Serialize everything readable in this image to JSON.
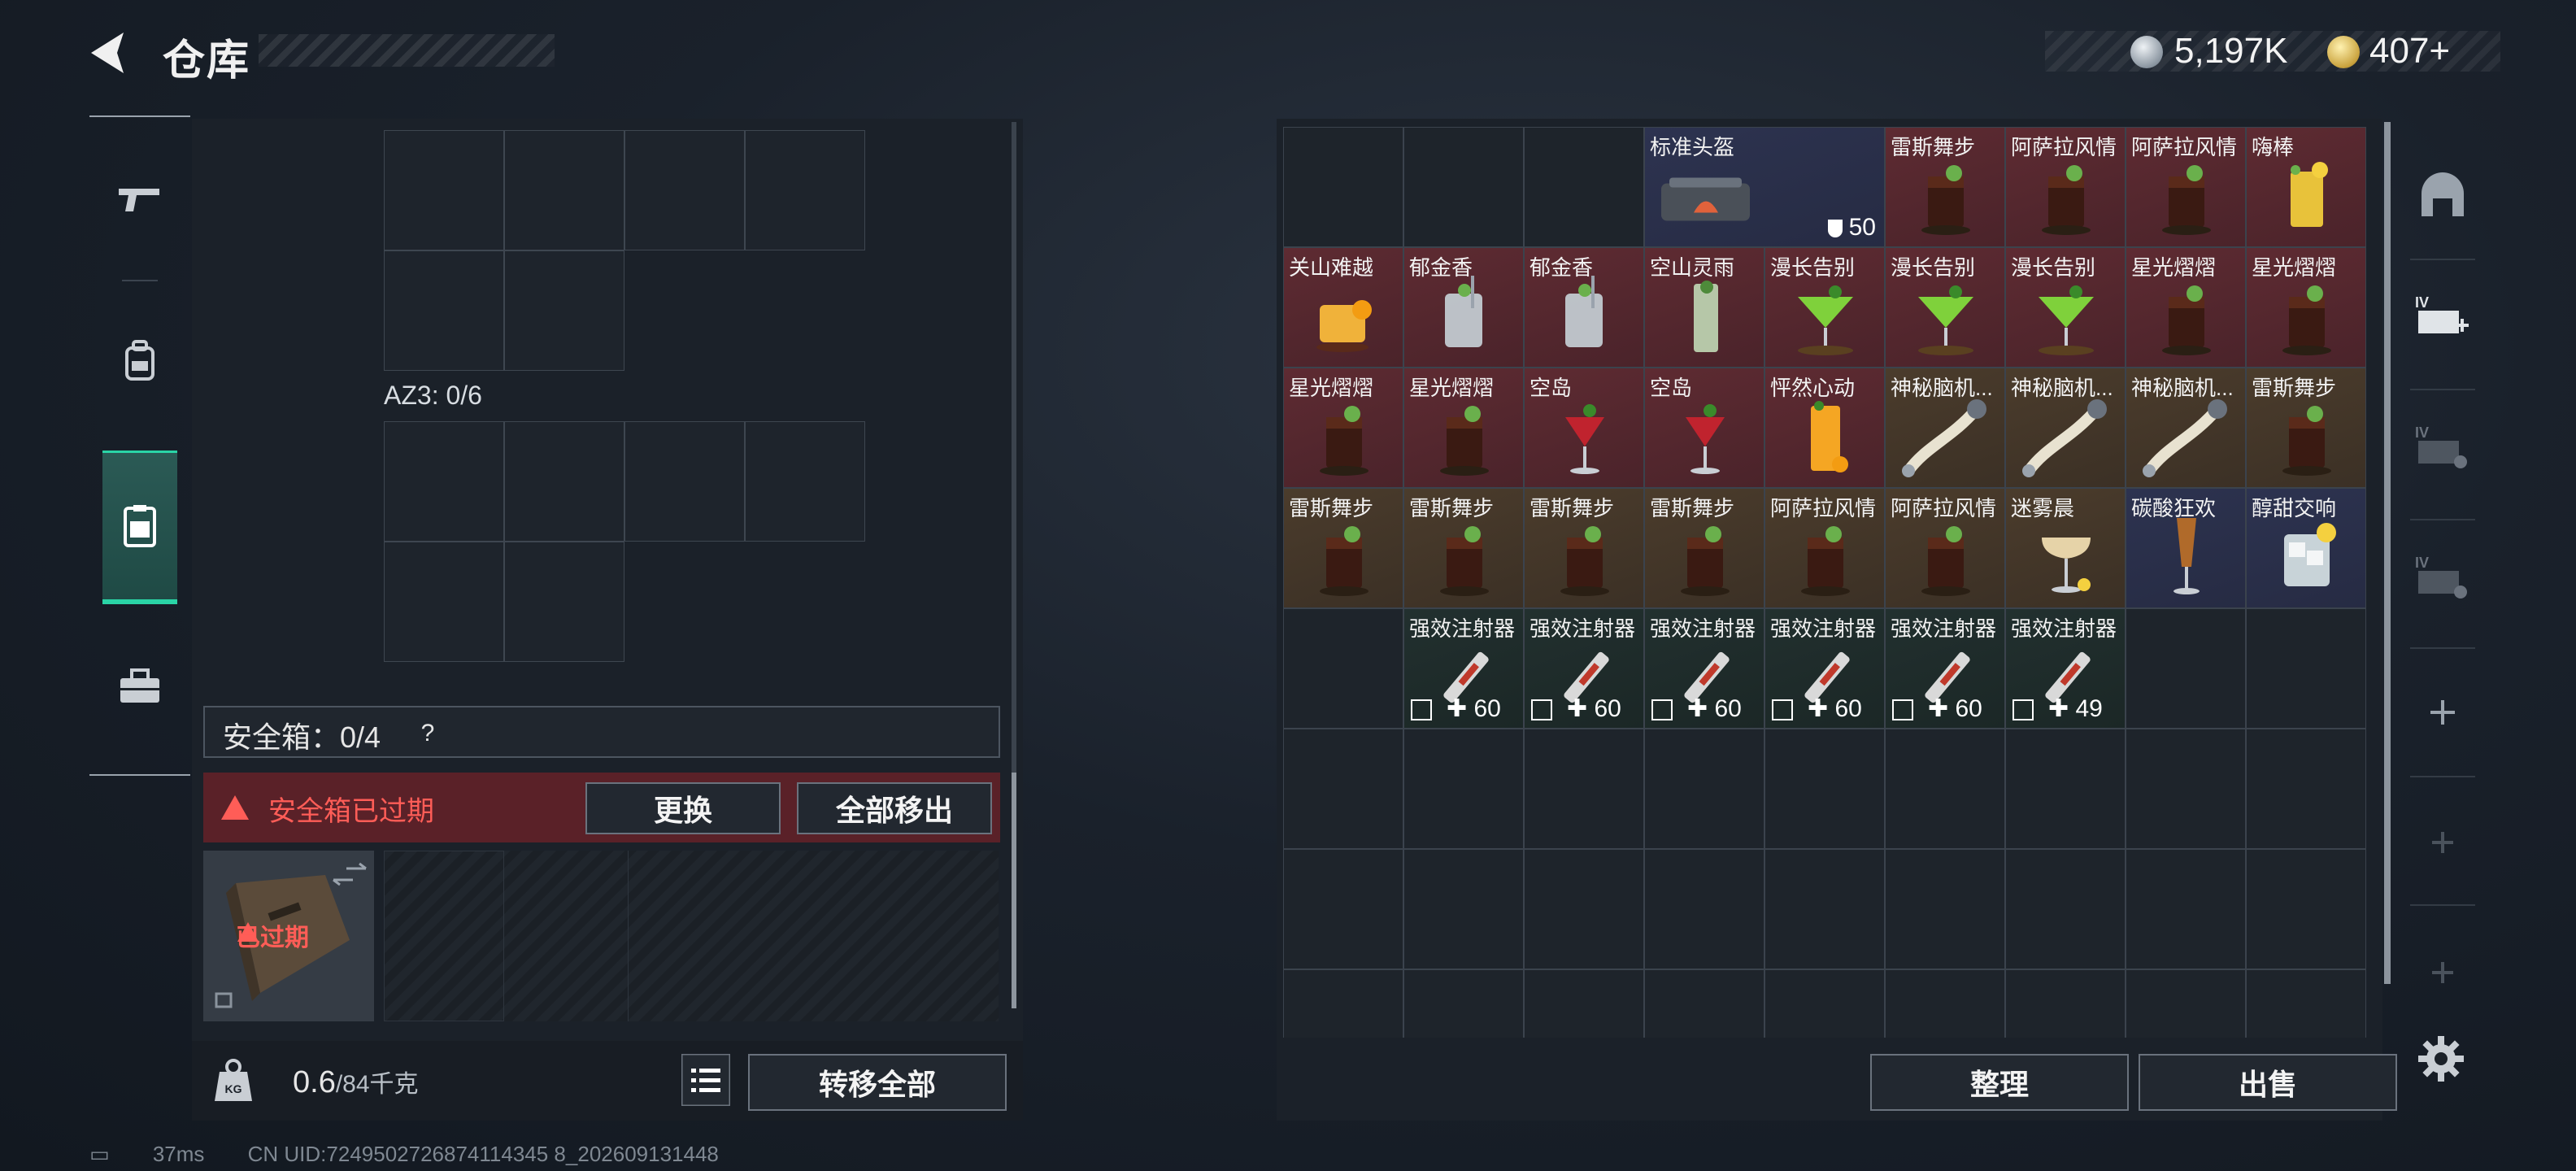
{
  "header": {
    "title": "仓库"
  },
  "currency": {
    "silver": "5,197K",
    "gold": "407+"
  },
  "left_tabs": [
    {
      "id": "weapons"
    },
    {
      "id": "backpack"
    },
    {
      "id": "container",
      "selected": true
    },
    {
      "id": "toolbox"
    }
  ],
  "container": {
    "az3_label": "AZ3: 0/6"
  },
  "safe_box": {
    "label": "安全箱：0/4",
    "help": "?",
    "expired_message": "安全箱已过期",
    "replace_label": "更换",
    "remove_all_label": "全部移出",
    "slot_expired": "已过期"
  },
  "weight": {
    "current": "0.6",
    "max": "/84千克"
  },
  "transfer_all_label": "转移全部",
  "inventory": {
    "rows": [
      [
        {
          "name": "",
          "bg": "empty"
        },
        {
          "name": "",
          "bg": "empty"
        },
        {
          "name": "",
          "bg": "empty"
        },
        {
          "name": "标准头盔",
          "bg": "navy",
          "icon": "bag",
          "qty": "50",
          "span": 2
        },
        {
          "name": "雷斯舞步",
          "bg": "red",
          "icon": "cola"
        },
        {
          "name": "阿萨拉风情",
          "bg": "red",
          "icon": "cola"
        },
        {
          "name": "阿萨拉风情",
          "bg": "red",
          "icon": "cola"
        },
        {
          "name": "嗨棒",
          "bg": "red",
          "icon": "highball"
        }
      ],
      [
        {
          "name": "关山难越",
          "bg": "red",
          "icon": "orange-drink"
        },
        {
          "name": "郁金香",
          "bg": "red",
          "icon": "tumbler"
        },
        {
          "name": "郁金香",
          "bg": "red",
          "icon": "tumbler"
        },
        {
          "name": "空山灵雨",
          "bg": "red",
          "icon": "tall-glass"
        },
        {
          "name": "漫长告别",
          "bg": "red",
          "icon": "martini"
        },
        {
          "name": "漫长告别",
          "bg": "red",
          "icon": "martini"
        },
        {
          "name": "漫长告别",
          "bg": "red",
          "icon": "martini"
        },
        {
          "name": "星光熠熠",
          "bg": "red",
          "icon": "cola"
        },
        {
          "name": "星光熠熠",
          "bg": "red",
          "icon": "cola"
        }
      ],
      [
        {
          "name": "星光熠熠",
          "bg": "red",
          "icon": "cola"
        },
        {
          "name": "星光熠熠",
          "bg": "red",
          "icon": "cola"
        },
        {
          "name": "空岛",
          "bg": "red",
          "icon": "red-cocktail"
        },
        {
          "name": "空岛",
          "bg": "red",
          "icon": "red-cocktail"
        },
        {
          "name": "怦然心动",
          "bg": "red",
          "icon": "orange-tall"
        },
        {
          "name": "神秘脑机...",
          "bg": "brown",
          "icon": "cable"
        },
        {
          "name": "神秘脑机...",
          "bg": "brown",
          "icon": "cable"
        },
        {
          "name": "神秘脑机...",
          "bg": "brown",
          "icon": "cable"
        },
        {
          "name": "雷斯舞步",
          "bg": "brown",
          "icon": "cola"
        }
      ],
      [
        {
          "name": "雷斯舞步",
          "bg": "brown",
          "icon": "cola"
        },
        {
          "name": "雷斯舞步",
          "bg": "brown",
          "icon": "cola"
        },
        {
          "name": "雷斯舞步",
          "bg": "brown",
          "icon": "cola"
        },
        {
          "name": "雷斯舞步",
          "bg": "brown",
          "icon": "cola"
        },
        {
          "name": "阿萨拉风情",
          "bg": "brown",
          "icon": "cola"
        },
        {
          "name": "阿萨拉风情",
          "bg": "brown",
          "icon": "cola"
        },
        {
          "name": "迷雾晨",
          "bg": "brown",
          "icon": "coupe"
        },
        {
          "name": "碳酸狂欢",
          "bg": "navy",
          "icon": "flute"
        },
        {
          "name": "醇甜交响",
          "bg": "navy",
          "icon": "ice-glass"
        }
      ],
      [
        {
          "name": "",
          "bg": "empty"
        },
        {
          "name": "强效注射器",
          "bg": "teal",
          "icon": "syringe",
          "qty": "60"
        },
        {
          "name": "强效注射器",
          "bg": "teal",
          "icon": "syringe",
          "qty": "60"
        },
        {
          "name": "强效注射器",
          "bg": "teal",
          "icon": "syringe",
          "qty": "60"
        },
        {
          "name": "强效注射器",
          "bg": "teal",
          "icon": "syringe",
          "qty": "60"
        },
        {
          "name": "强效注射器",
          "bg": "teal",
          "icon": "syringe",
          "qty": "60"
        },
        {
          "name": "强效注射器",
          "bg": "teal",
          "icon": "syringe",
          "qty": "49"
        },
        {
          "name": "",
          "bg": "empty"
        },
        {
          "name": "",
          "bg": "empty"
        }
      ]
    ],
    "empty_rows": 3
  },
  "sort_label": "整理",
  "sell_label": "出售",
  "status_bar": {
    "ping": "37ms",
    "uid": "CN UID:7249502726874114345 8_202609131448"
  },
  "colors": {
    "accent": "#2ad4a6",
    "warning": "#ff5d57",
    "panel": "#1b2129",
    "item_red": "#5e2b32",
    "item_brown": "#4b3c2c",
    "item_navy": "#2d3350"
  }
}
